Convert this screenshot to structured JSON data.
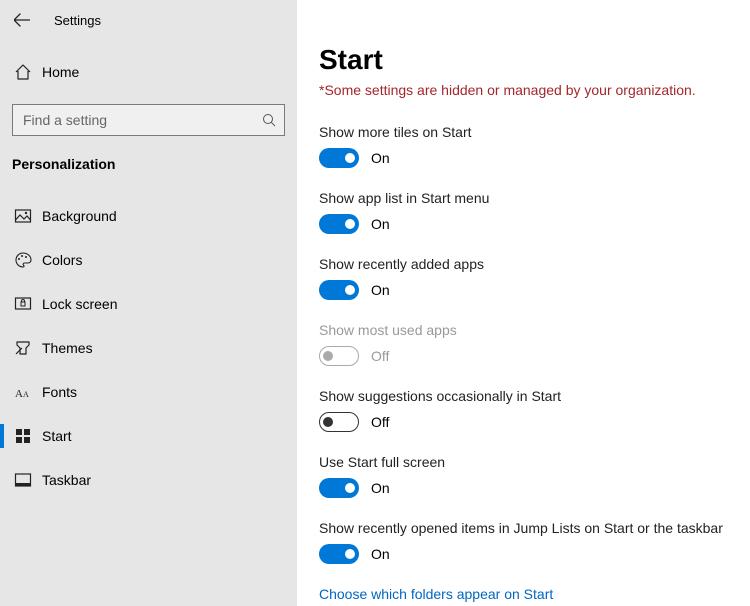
{
  "window": {
    "title": "Settings"
  },
  "sidebar": {
    "home_label": "Home",
    "search_placeholder": "Find a setting",
    "section_title": "Personalization",
    "items": [
      {
        "key": "background",
        "label": "Background"
      },
      {
        "key": "colors",
        "label": "Colors"
      },
      {
        "key": "lock-screen",
        "label": "Lock screen"
      },
      {
        "key": "themes",
        "label": "Themes"
      },
      {
        "key": "fonts",
        "label": "Fonts"
      },
      {
        "key": "start",
        "label": "Start"
      },
      {
        "key": "taskbar",
        "label": "Taskbar"
      }
    ],
    "selected_key": "start"
  },
  "page": {
    "title": "Start",
    "policy_notice": "*Some settings are hidden or managed by your organization.",
    "toggle_on_text": "On",
    "toggle_off_text": "Off",
    "settings": [
      {
        "key": "more-tiles",
        "label": "Show more tiles on Start",
        "on": true,
        "enabled": true
      },
      {
        "key": "app-list",
        "label": "Show app list in Start menu",
        "on": true,
        "enabled": true
      },
      {
        "key": "recently-added",
        "label": "Show recently added apps",
        "on": true,
        "enabled": true
      },
      {
        "key": "most-used",
        "label": "Show most used apps",
        "on": false,
        "enabled": false
      },
      {
        "key": "suggestions",
        "label": "Show suggestions occasionally in Start",
        "on": false,
        "enabled": true
      },
      {
        "key": "full-screen",
        "label": "Use Start full screen",
        "on": true,
        "enabled": true
      },
      {
        "key": "jump-lists",
        "label": "Show recently opened items in Jump Lists on Start or the taskbar",
        "on": true,
        "enabled": true
      }
    ],
    "folders_link": "Choose which folders appear on Start"
  }
}
